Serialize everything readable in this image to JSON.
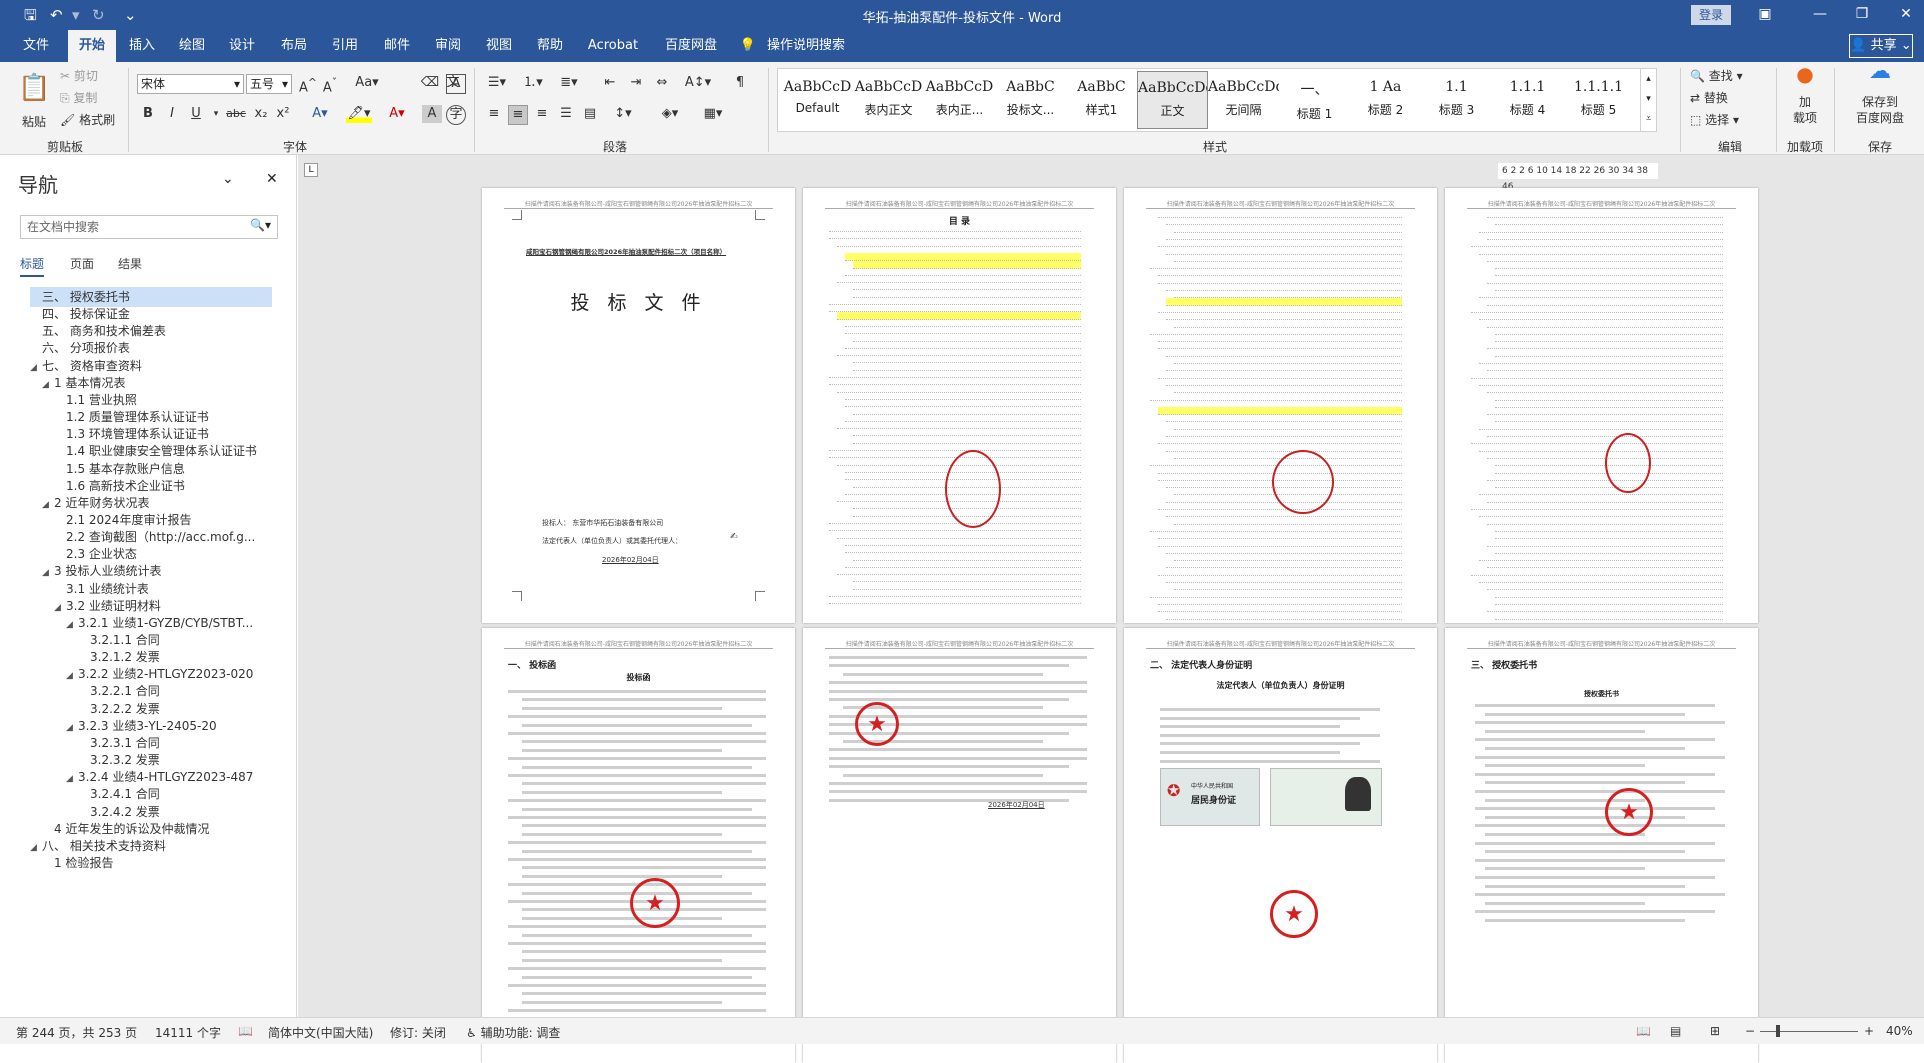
{
  "titlebar": {
    "title": "华拓-抽油泵配件-投标文件 - Word",
    "login": "登录",
    "save_icon": "save-icon",
    "undo_icon": "undo-icon",
    "redo_icon": "redo-icon"
  },
  "tabs": [
    "文件",
    "开始",
    "插入",
    "绘图",
    "设计",
    "布局",
    "引用",
    "邮件",
    "审阅",
    "视图",
    "帮助",
    "Acrobat",
    "百度网盘"
  ],
  "tell_me": "操作说明搜索",
  "share": "共享",
  "ribbon": {
    "clipboard": {
      "paste": "粘贴",
      "cut": "剪切",
      "copy": "复制",
      "format_painter": "格式刷",
      "label": "剪贴板"
    },
    "font": {
      "name": "宋体",
      "size": "五号",
      "label": "字体",
      "bold": "B",
      "italic": "I",
      "underline": "U",
      "strike": "abc",
      "sub": "x₂",
      "sup": "x²"
    },
    "paragraph": {
      "label": "段落"
    },
    "styles": {
      "label": "样式",
      "items": [
        {
          "preview": "AaBbCcD",
          "name": "Default"
        },
        {
          "preview": "AaBbCcD",
          "name": "表内正文"
        },
        {
          "preview": "AaBbCcD",
          "name": "表内正..."
        },
        {
          "preview": "AaBbC",
          "name": "投标文..."
        },
        {
          "preview": "AaBbC",
          "name": "样式1"
        },
        {
          "preview": "AaBbCcDd",
          "name": "正文"
        },
        {
          "preview": "AaBbCcDd",
          "name": "无间隔"
        },
        {
          "preview": "一、",
          "name": "标题 1"
        },
        {
          "preview": "1 Aa",
          "name": "标题 2"
        },
        {
          "preview": "1.1",
          "name": "标题 3"
        },
        {
          "preview": "1.1.1",
          "name": "标题 4"
        },
        {
          "preview": "1.1.1.1",
          "name": "标题 5"
        }
      ]
    },
    "editing": {
      "find": "查找",
      "replace": "替换",
      "select": "选择",
      "label": "编辑"
    },
    "addin": {
      "name": "加\n载项",
      "label": "加载项"
    },
    "save_baidu": {
      "name": "保存到\n百度网盘",
      "label": "保存"
    }
  },
  "nav": {
    "title": "导航",
    "search_placeholder": "在文档中搜索",
    "tabs": [
      "标题",
      "页面",
      "结果"
    ],
    "items": [
      {
        "text": "三、 授权委托书",
        "level": 0,
        "sel": true
      },
      {
        "text": "四、 投标保证金",
        "level": 0
      },
      {
        "text": "五、 商务和技术偏差表",
        "level": 0
      },
      {
        "text": "六、 分项报价表",
        "level": 0
      },
      {
        "text": "七、 资格审查资料",
        "level": 0,
        "tw": "◢"
      },
      {
        "text": "1 基本情况表",
        "level": 1,
        "tw": "◢"
      },
      {
        "text": "1.1 营业执照",
        "level": 2
      },
      {
        "text": "1.2 质量管理体系认证证书",
        "level": 2
      },
      {
        "text": "1.3 环境管理体系认证证书",
        "level": 2
      },
      {
        "text": "1.4 职业健康安全管理体系认证证书",
        "level": 2
      },
      {
        "text": "1.5 基本存款账户信息",
        "level": 2
      },
      {
        "text": "1.6 高新技术企业证书",
        "level": 2
      },
      {
        "text": "2 近年财务状况表",
        "level": 1,
        "tw": "◢"
      },
      {
        "text": "2.1 2024年度审计报告",
        "level": 2
      },
      {
        "text": "2.2 查询截图（http://acc.mof.g...",
        "level": 2
      },
      {
        "text": "2.3 企业状态",
        "level": 2
      },
      {
        "text": "3 投标人业绩统计表",
        "level": 1,
        "tw": "◢"
      },
      {
        "text": "3.1 业绩统计表",
        "level": 2
      },
      {
        "text": "3.2 业绩证明材料",
        "level": 2,
        "tw": "◢"
      },
      {
        "text": "3.2.1 业绩1-GYZB/CYB/STBT...",
        "level": 3,
        "tw": "◢"
      },
      {
        "text": "3.2.1.1 合同",
        "level": 4
      },
      {
        "text": "3.2.1.2 发票",
        "level": 4
      },
      {
        "text": "3.2.2 业绩2-HTLGYZ2023-020",
        "level": 3,
        "tw": "◢"
      },
      {
        "text": "3.2.2.1 合同",
        "level": 4
      },
      {
        "text": "3.2.2.2 发票",
        "level": 4
      },
      {
        "text": "3.2.3 业绩3-YL-2405-20",
        "level": 3,
        "tw": "◢"
      },
      {
        "text": "3.2.3.1 合同",
        "level": 4
      },
      {
        "text": "3.2.3.2 发票",
        "level": 4
      },
      {
        "text": "3.2.4 业绩4-HTLGYZ2023-487",
        "level": 3,
        "tw": "◢"
      },
      {
        "text": "3.2.4.1 合同",
        "level": 4
      },
      {
        "text": "3.2.4.2 发票",
        "level": 4
      },
      {
        "text": "4 近年发生的诉讼及仲裁情况",
        "level": 1
      },
      {
        "text": "八、 相关技术支持资料",
        "level": 0,
        "tw": "◢"
      },
      {
        "text": "1 检验报告",
        "level": 1
      }
    ]
  },
  "ruler": "6  2 2  6 10 14 18 22 26 30 34 38   46",
  "pages": {
    "header": "扫描件请阅石油装备有限公司-咸阳宝石钢管钢绳有限公司2026年抽油泵配件招标二次",
    "p1": {
      "project": "咸阳宝石钢管钢绳有限公司2026年抽油泵配件招标二次（项目名称）",
      "title": "投 标 文 件",
      "bidder": "投标人：  东营市华拓石油装备有限公司",
      "legal": "法定代表人（单位负责人）或其委托代理人：",
      "date": "2026年02月04日"
    },
    "p2": {
      "title": "目  录"
    },
    "p5": {
      "heading": "一、 投标函",
      "sub": "投标函"
    },
    "p6": {
      "date": "2026年02月04日"
    },
    "p7": {
      "heading": "二、 法定代表人身份证明",
      "sub": "法定代表人（单位负责人）身份证明",
      "id_title": "中华人民共和国",
      "id_sub": "居民身份证"
    },
    "p8": {
      "heading": "三、 授权委托书",
      "sub": "授权委托书"
    }
  },
  "status": {
    "page": "第 244 页，共 253 页",
    "words": "14111 个字",
    "lang": "简体中文(中国大陆)",
    "track": "修订: 关闭",
    "access": "辅助功能: 调查",
    "zoom": "40%"
  }
}
